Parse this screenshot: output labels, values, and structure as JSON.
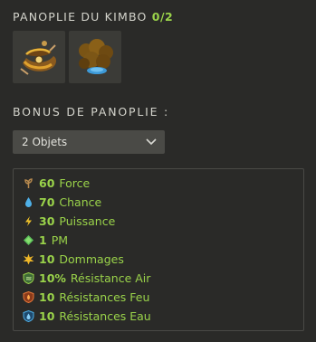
{
  "panoply": {
    "title": "PANOPLIE DU KIMBO",
    "count": "0/2",
    "items": [
      {
        "icon": "kimbo-belt-icon"
      },
      {
        "icon": "kimbo-boots-icon"
      }
    ]
  },
  "bonus": {
    "heading": "BONUS DE PANOPLIE :",
    "selected": "2 Objets",
    "stats": [
      {
        "icon": "force-icon",
        "value": "60",
        "label": "Force"
      },
      {
        "icon": "chance-icon",
        "value": "70",
        "label": "Chance"
      },
      {
        "icon": "puissance-icon",
        "value": "30",
        "label": "Puissance"
      },
      {
        "icon": "pm-icon",
        "value": "1",
        "label": "PM"
      },
      {
        "icon": "dommages-icon",
        "value": "10",
        "label": "Dommages"
      },
      {
        "icon": "resistance-air-icon",
        "value": "10%",
        "label": "Résistance Air"
      },
      {
        "icon": "resistance-feu-icon",
        "value": "10",
        "label": "Résistances Feu"
      },
      {
        "icon": "resistance-eau-icon",
        "value": "10",
        "label": "Résistances Eau"
      }
    ]
  },
  "colors": {
    "background": "#2a2a28",
    "accent_green": "#9ad34a",
    "slot": "#3b3b37",
    "dropdown": "#4a4a46"
  }
}
